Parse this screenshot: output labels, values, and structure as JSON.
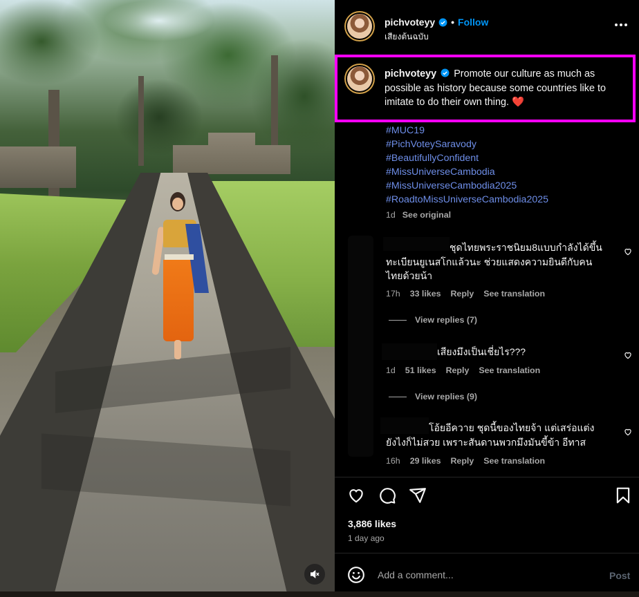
{
  "post": {
    "username": "pichvoteyy",
    "follow_label": "Follow",
    "separator": "•",
    "audio_label": "เสียงต้นฉบับ",
    "more_icon": "more-horizontal-icon",
    "caption_username": "pichvoteyy",
    "caption_text": "Promote our culture as much as possible as history because some countries like to imitate to do their own thing. ❤️",
    "hashtags": [
      "#MUC19",
      "#PichVoteySaravody",
      "#BeautifullyConfident",
      "#MissUniverseCambodia",
      "#MissUniverseCambodia2025",
      "#RoadtoMissUniverseCambodia2025"
    ],
    "caption_age": "1d",
    "see_original": "See original",
    "highlight_color": "#ff00ff",
    "link_color": "#6e8ee8",
    "accent_color": "#0095f6"
  },
  "comments": [
    {
      "text_line1": "ชุดไทยพระราชนิยม8แบบกำลังได้ขึ้น",
      "text_line2": "ทะเบียนยูเนสโกแล้วนะ ช่วยแสดงความยินดีกับคน",
      "text_line3": "ไทยด้วยน้า",
      "age": "17h",
      "likes": "33 likes",
      "reply": "Reply",
      "translate": "See translation",
      "view_replies": "View replies (7)"
    },
    {
      "text_line1": "เสียงมึงเป็นเชี่ยไร???",
      "age": "1d",
      "likes": "51 likes",
      "reply": "Reply",
      "translate": "See translation",
      "view_replies": "View replies (9)"
    },
    {
      "text_line1": "โอ้ยอีควาย ชุดนี้ของไทยจ้า แต่เสร่อแต่ง",
      "text_line2": "ยังไงก็ไม่สวย เพราะสันดานพวกมึงมันขี้ข้า อีทาส",
      "age": "16h",
      "likes": "29 likes",
      "reply": "Reply",
      "translate": "See translation"
    }
  ],
  "footer": {
    "likes": "3,886 likes",
    "time_ago": "1 day ago",
    "comment_placeholder": "Add a comment...",
    "post_label": "Post",
    "icons": [
      "heart-icon",
      "comment-icon",
      "share-icon",
      "bookmark-icon",
      "emoji-icon"
    ]
  },
  "media": {
    "mute_icon": "speaker-muted-icon"
  }
}
